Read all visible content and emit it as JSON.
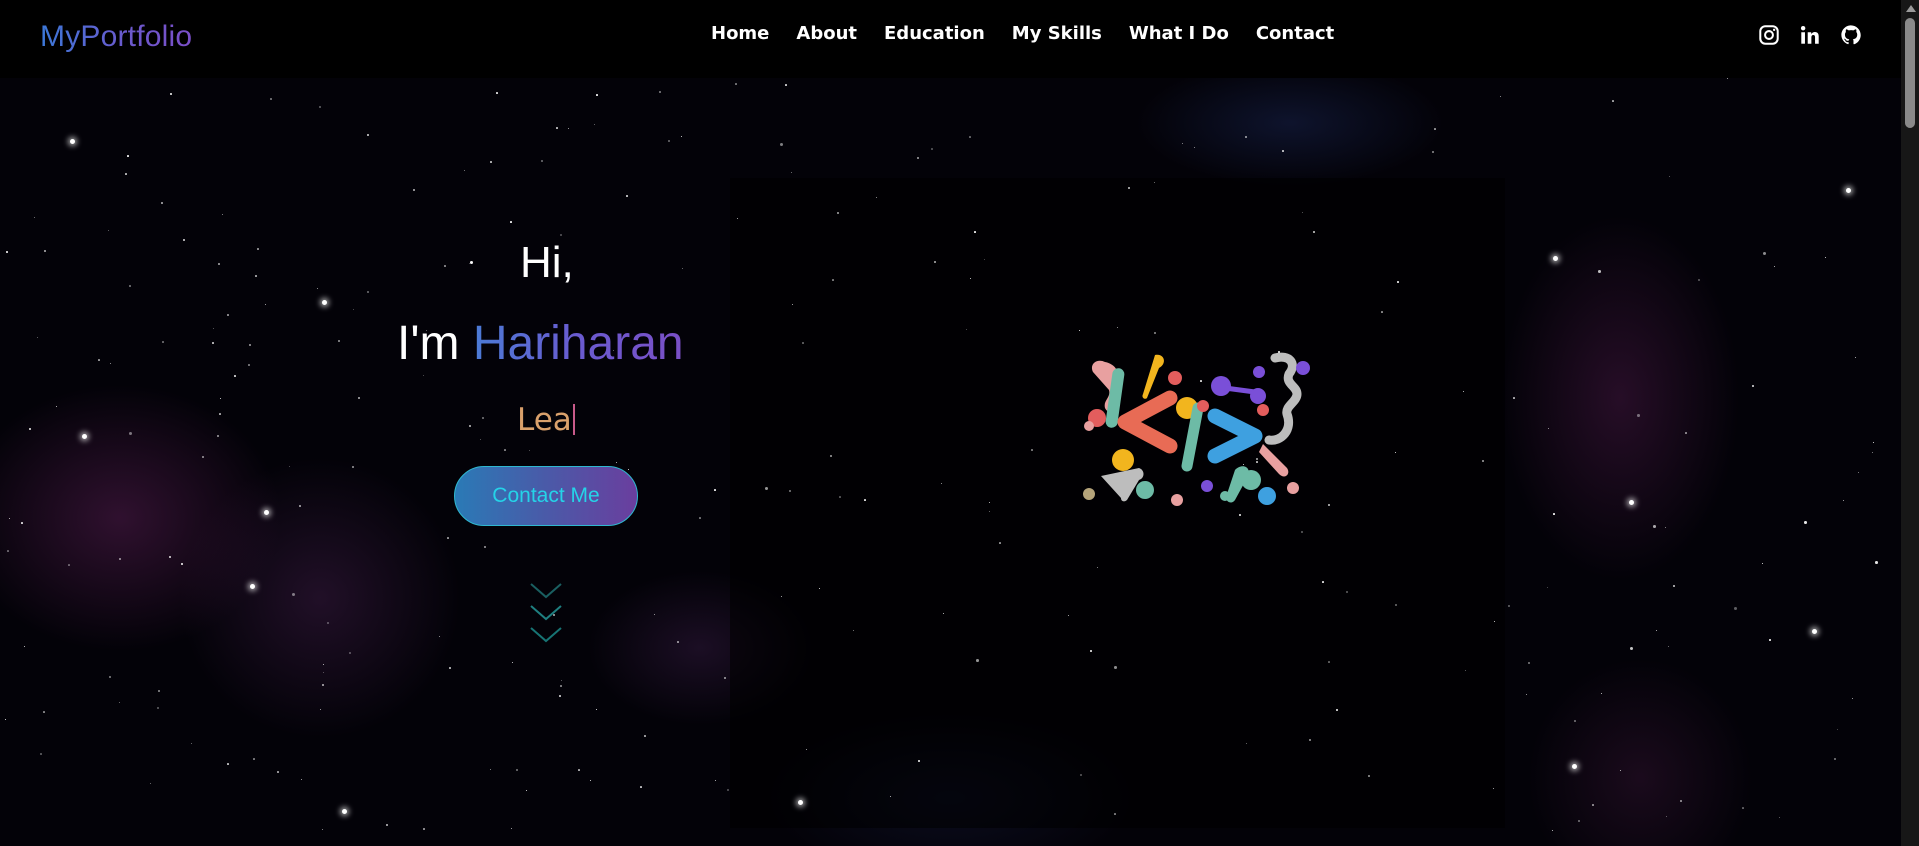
{
  "header": {
    "logo": "MyPortfolio",
    "nav": [
      {
        "label": "Home"
      },
      {
        "label": "About"
      },
      {
        "label": "Education"
      },
      {
        "label": "My Skills"
      },
      {
        "label": "What I Do"
      },
      {
        "label": "Contact"
      }
    ],
    "social_icons": [
      "instagram-icon",
      "linkedin-icon",
      "github-icon"
    ]
  },
  "hero": {
    "greeting": "Hi,",
    "intro": "I'm",
    "name": "Hariharan",
    "typing_text": "Lea",
    "cta_label": "Contact Me",
    "scroll_icon": "chevron-down-icon"
  },
  "colors": {
    "background": "#000000",
    "logo_gradient": [
      "#3b78d8",
      "#7b4fc9"
    ],
    "cta_text": "#25d3e8",
    "typing_text": "#d9a06b",
    "scroll_arrows": "#1e7f80"
  },
  "illustration": {
    "icon": "code-brackets-icon"
  }
}
